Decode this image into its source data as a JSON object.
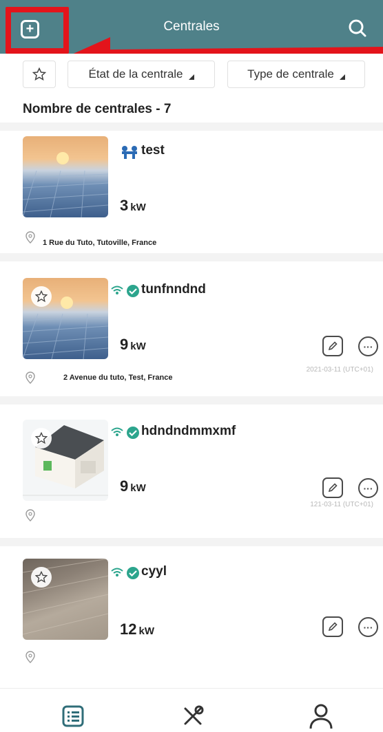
{
  "header": {
    "title": "Centrales",
    "add_icon": "plus-square-icon",
    "search_icon": "search-icon"
  },
  "filters": {
    "favorite_icon": "star-icon",
    "state_label": "État de la centrale",
    "type_label": "Type de centrale"
  },
  "count_label": "Nombre de centrales - 7",
  "plants": [
    {
      "name": "test",
      "power_value": "3",
      "power_unit": "kW",
      "address": "1 Rue du Tuto,  Tutoville, France",
      "date": ""
    },
    {
      "name": "tunfnndnd",
      "power_value": "9",
      "power_unit": "kW",
      "address": "2 Avenue du tuto, Test, France",
      "date": "2021-03-11 (UTC+01)"
    },
    {
      "name": "hdndndmmxmf",
      "power_value": "9",
      "power_unit": "kW",
      "address": "",
      "date": "121-03-11 (UTC+01)"
    },
    {
      "name": "cyyl",
      "power_value": "12",
      "power_unit": "kW",
      "address": "",
      "date": ""
    }
  ],
  "nav": {
    "list_icon": "list-icon",
    "tools_icon": "tools-icon",
    "profile_icon": "user-icon"
  },
  "colors": {
    "header": "#4f8189",
    "highlight": "#e3141b",
    "status_green": "#2ca58d"
  }
}
